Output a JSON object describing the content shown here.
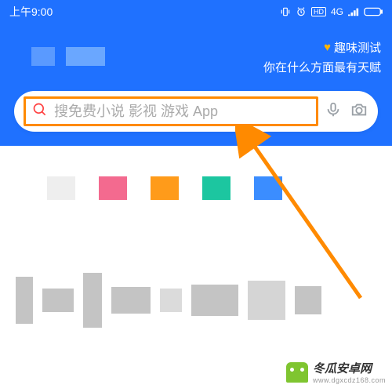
{
  "status": {
    "time": "上午9:00",
    "network": "4G"
  },
  "promo": {
    "line1": "趣味测试",
    "line2": "你在什么方面最有天赋"
  },
  "search": {
    "placeholder": "搜免费小说 影视 游戏 App"
  },
  "watermark": {
    "name": "冬瓜安卓网",
    "domain": "www.dgxcdz168.com"
  }
}
